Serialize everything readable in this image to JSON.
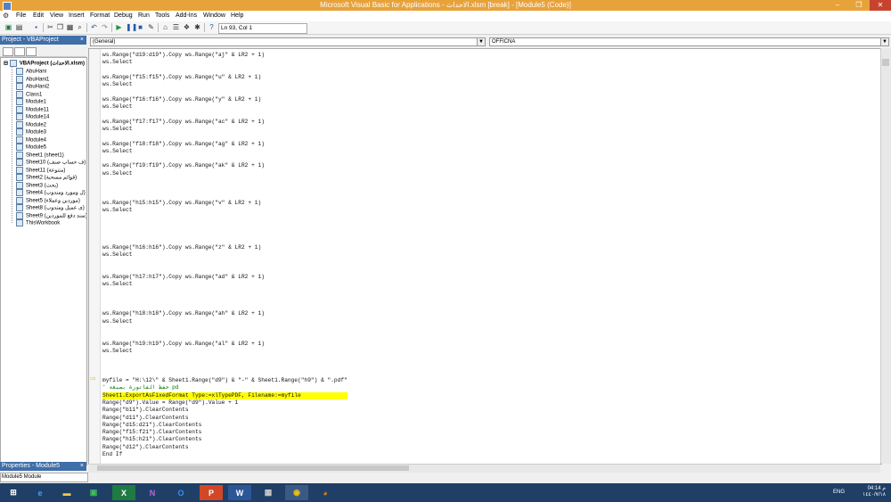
{
  "window": {
    "title": "Microsoft Visual Basic for Applications - الاحداث.xlsm [break] - [Module5 (Code)]"
  },
  "menu": [
    "File",
    "Edit",
    "View",
    "Insert",
    "Format",
    "Debug",
    "Run",
    "Tools",
    "Add-Ins",
    "Window",
    "Help"
  ],
  "toolbar": {
    "position": "Ln 93, Col 1"
  },
  "project": {
    "header": "Project - VBAProject",
    "root": "VBAProject (الاحداث.xlsm)",
    "items": [
      "AbuHani",
      "AbuHani1",
      "AbuHani2",
      "Class1",
      "Module1",
      "Module11",
      "Module14",
      "Module2",
      "Module3",
      "Module4",
      "Module5",
      "Sheet1 (sheet1)",
      "Sheet10 (ف حساب صنف)",
      "Sheet11 (متنوعة)",
      "Sheet2 (قوائم مسحبة)",
      "Sheet3 (بحث)",
      "Sheet4 (ل ومورد ومندوب)",
      "Sheet5 (موردين وعملاء)",
      "Sheet8 (ى عميل ومندوب)",
      "Sheet9 (سند دفع للموردين)",
      "ThisWorkbook"
    ]
  },
  "properties": {
    "header": "Properties - Module5",
    "selected": "Module5 Module"
  },
  "code": {
    "object_combo": "(General)",
    "proc_combo": "OFFICNA",
    "lines": [
      "ws.Range(\"d19:d19\").Copy ws.Range(\"aj\" & LR2 + 1)",
      "ws.Select",
      "",
      "ws.Range(\"f15:f15\").Copy ws.Range(\"u\" & LR2 + 1)",
      "ws.Select",
      "",
      "ws.Range(\"f16:f16\").Copy ws.Range(\"y\" & LR2 + 1)",
      "ws.Select",
      "",
      "ws.Range(\"f17:f17\").Copy ws.Range(\"ac\" & LR2 + 1)",
      "ws.Select",
      "",
      "ws.Range(\"f18:f18\").Copy ws.Range(\"ag\" & LR2 + 1)",
      "ws.Select",
      "",
      "ws.Range(\"f19:f19\").Copy ws.Range(\"ak\" & LR2 + 1)",
      "ws.Select",
      "",
      "",
      "",
      "ws.Range(\"h15:h15\").Copy ws.Range(\"v\" & LR2 + 1)",
      "ws.Select",
      "",
      "",
      "",
      "",
      "ws.Range(\"h16:h16\").Copy ws.Range(\"z\" & LR2 + 1)",
      "ws.Select",
      "",
      "",
      "ws.Range(\"h17:h17\").Copy ws.Range(\"ad\" & LR2 + 1)",
      "ws.Select",
      "",
      "",
      "",
      "ws.Range(\"h18:h18\").Copy ws.Range(\"ah\" & LR2 + 1)",
      "ws.Select",
      "",
      "",
      "ws.Range(\"h19:h19\").Copy ws.Range(\"al\" & LR2 + 1)",
      "ws.Select",
      "",
      "",
      "",
      "myfile = \"H:\\12\\\" & Sheet1.Range(\"d9\") & \"-\" & Sheet1.Range(\"h9\") & \".pdf\"",
      "' حفظ الفاتورة بصيغة pd",
      "Sheet1.ExportAsFixedFormat Type:=xlTypePDF, Filename:=myfile",
      "Range(\"d9\").Value = Range(\"d9\").Value + 1",
      "Range(\"b11\").ClearContents",
      "Range(\"d11\").ClearContents",
      "Range(\"d15:d21\").ClearContents",
      "Range(\"f15:f21\").ClearContents",
      "Range(\"h15:h21\").ClearContents",
      "Range(\"d12\").ClearContents",
      "End If",
      "",
      "End Sub"
    ],
    "highlight_index": 46,
    "comment_index": 45
  },
  "taskbar": {
    "apps": [
      "start",
      "ie",
      "explorer",
      "store",
      "excel",
      "onenote",
      "outlook",
      "powerpoint",
      "word",
      "calculator",
      "chrome",
      "firefox"
    ],
    "lang": "ENG",
    "time": "04:14 م",
    "date": "١٤٤٠/٧/١٨"
  }
}
